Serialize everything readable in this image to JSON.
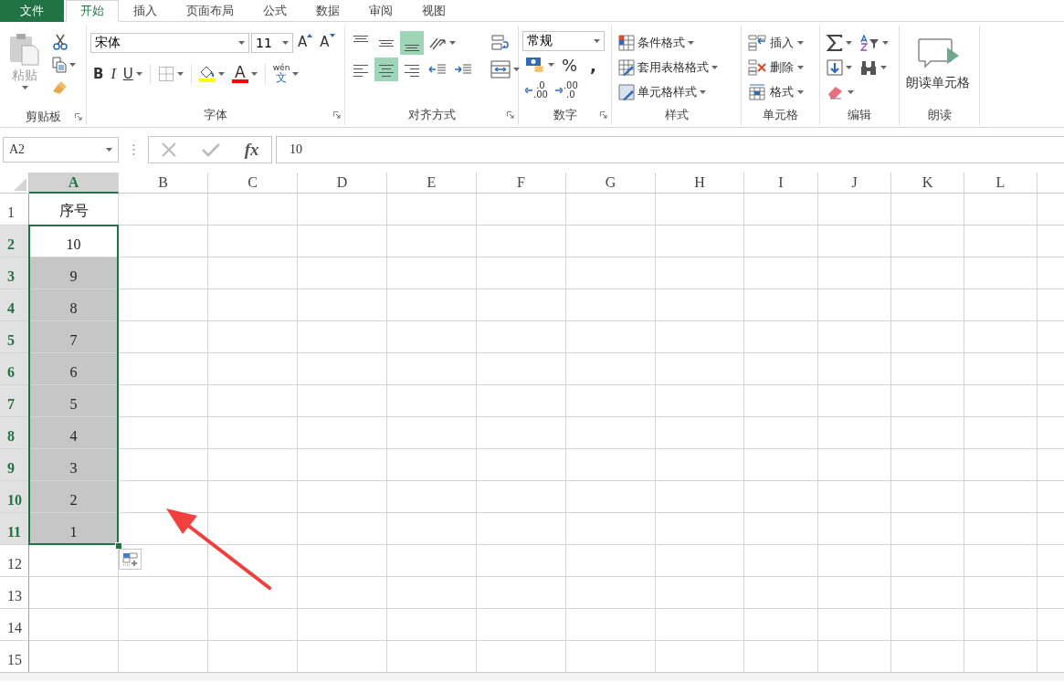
{
  "tabs": [
    {
      "label": "文件",
      "kind": "file",
      "selected": false
    },
    {
      "label": "开始",
      "kind": "tab",
      "selected": true
    },
    {
      "label": "插入",
      "kind": "tab",
      "selected": false
    },
    {
      "label": "页面布局",
      "kind": "tab",
      "selected": false
    },
    {
      "label": "公式",
      "kind": "tab",
      "selected": false
    },
    {
      "label": "数据",
      "kind": "tab",
      "selected": false
    },
    {
      "label": "审阅",
      "kind": "tab",
      "selected": false
    },
    {
      "label": "视图",
      "kind": "tab",
      "selected": false
    }
  ],
  "ribbon": {
    "groups": [
      {
        "kind": "clipboard",
        "label": "剪贴板",
        "launcher": true,
        "paste": {
          "label": "粘贴",
          "disabled": true
        }
      },
      {
        "kind": "font",
        "label": "字体",
        "launcher": true,
        "font_name": "宋体",
        "font_size": "11",
        "grow": "A",
        "shrink": "A",
        "bold": "B",
        "italic": "I",
        "underline": "U",
        "fill": {
          "color": "#ffff00"
        },
        "font_color": {
          "glyph": "A",
          "color": "#ff0000"
        },
        "phonetic": "wén",
        "phonetic_base": "文"
      },
      {
        "kind": "alignment",
        "label": "对齐方式",
        "launcher": true,
        "vertical": [
          {
            "kind": "top",
            "selected": false
          },
          {
            "kind": "middle",
            "selected": false
          },
          {
            "kind": "bottom",
            "selected": true
          }
        ],
        "horizontal": [
          {
            "kind": "left",
            "selected": false
          },
          {
            "kind": "center",
            "selected": true
          },
          {
            "kind": "right",
            "selected": false
          }
        ]
      },
      {
        "kind": "number",
        "label": "数字",
        "launcher": true,
        "format": "常规",
        "percent": "%",
        "comma": ",",
        "decimals": [
          {
            "kind": "increase",
            "top": ".0",
            "bottom": ".00"
          },
          {
            "kind": "decrease",
            "top": ".00",
            "bottom": ".0"
          }
        ]
      },
      {
        "kind": "styles",
        "label": "样式",
        "launcher": false,
        "items": [
          "条件格式",
          "套用表格格式",
          "单元格样式"
        ]
      },
      {
        "kind": "cells",
        "label": "单元格",
        "launcher": false,
        "items": [
          "插入",
          "删除",
          "格式"
        ]
      },
      {
        "kind": "editing",
        "label": "编辑",
        "launcher": false
      },
      {
        "kind": "read",
        "label": "朗读",
        "launcher": false,
        "button": "朗读单元格"
      }
    ]
  },
  "formula_bar": {
    "name_box": "A2",
    "fx": "fx",
    "value": "10"
  },
  "sheet": {
    "columns": [
      {
        "label": "A",
        "selected": true
      },
      {
        "label": "B",
        "selected": false
      },
      {
        "label": "C",
        "selected": false
      },
      {
        "label": "D",
        "selected": false
      },
      {
        "label": "E",
        "selected": false
      },
      {
        "label": "F",
        "selected": false
      },
      {
        "label": "G",
        "selected": false
      },
      {
        "label": "H",
        "selected": false
      },
      {
        "label": "I",
        "selected": false
      },
      {
        "label": "J",
        "selected": false
      },
      {
        "label": "K",
        "selected": false
      },
      {
        "label": "L",
        "selected": false
      }
    ],
    "rows": [
      {
        "label": "1",
        "selected": false,
        "cells": [
          {
            "text": "序号",
            "selected": false,
            "active": false
          }
        ]
      },
      {
        "label": "2",
        "selected": true,
        "cells": [
          {
            "text": "10",
            "selected": false,
            "active": true
          }
        ]
      },
      {
        "label": "3",
        "selected": true,
        "cells": [
          {
            "text": "9",
            "selected": true,
            "active": false
          }
        ]
      },
      {
        "label": "4",
        "selected": true,
        "cells": [
          {
            "text": "8",
            "selected": true,
            "active": false
          }
        ]
      },
      {
        "label": "5",
        "selected": true,
        "cells": [
          {
            "text": "7",
            "selected": true,
            "active": false
          }
        ]
      },
      {
        "label": "6",
        "selected": true,
        "cells": [
          {
            "text": "6",
            "selected": true,
            "active": false
          }
        ]
      },
      {
        "label": "7",
        "selected": true,
        "cells": [
          {
            "text": "5",
            "selected": true,
            "active": false
          }
        ]
      },
      {
        "label": "8",
        "selected": true,
        "cells": [
          {
            "text": "4",
            "selected": true,
            "active": false
          }
        ]
      },
      {
        "label": "9",
        "selected": true,
        "cells": [
          {
            "text": "3",
            "selected": true,
            "active": false
          }
        ]
      },
      {
        "label": "10",
        "selected": true,
        "cells": [
          {
            "text": "2",
            "selected": true,
            "active": false
          }
        ]
      },
      {
        "label": "11",
        "selected": true,
        "cells": [
          {
            "text": "1",
            "selected": true,
            "active": false
          }
        ]
      },
      {
        "label": "12",
        "selected": false,
        "cells": []
      },
      {
        "label": "13",
        "selected": false,
        "cells": []
      },
      {
        "label": "14",
        "selected": false,
        "cells": []
      },
      {
        "label": "15",
        "selected": false,
        "cells": []
      }
    ]
  }
}
